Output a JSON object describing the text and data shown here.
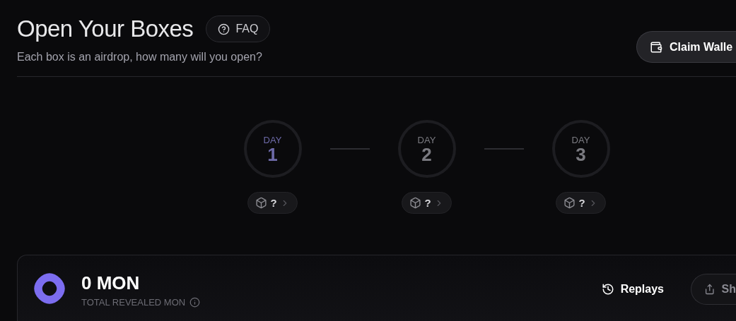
{
  "header": {
    "title": "Open Your Boxes",
    "faq_button": "FAQ",
    "subtitle": "Each box is an airdrop, how many will you open?",
    "claim_button": "Claim Walle"
  },
  "days": [
    {
      "label": "DAY",
      "number": "1",
      "selected": true,
      "reward": "?"
    },
    {
      "label": "DAY",
      "number": "2",
      "selected": false,
      "reward": "?"
    },
    {
      "label": "DAY",
      "number": "3",
      "selected": false,
      "reward": "?"
    }
  ],
  "summary": {
    "amount": "0 MON",
    "caption": "TOTAL REVEALED MON",
    "replays_button": "Replays",
    "share_button": "Sh"
  }
}
